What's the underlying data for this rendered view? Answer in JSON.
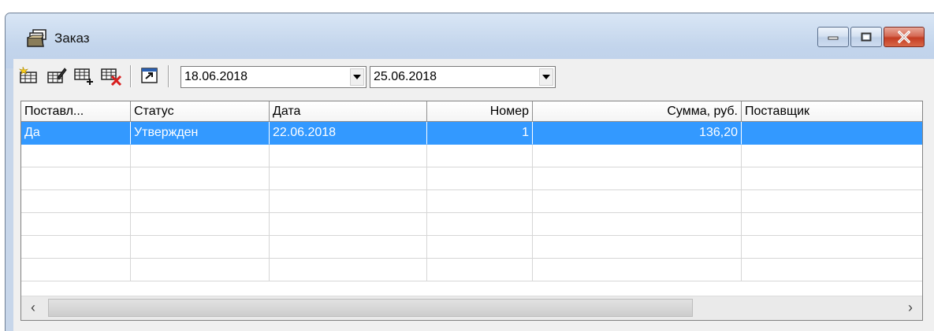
{
  "window": {
    "title": "Заказ",
    "icon": "stacked-documents-icon"
  },
  "toolbar": {
    "buttons": [
      {
        "icon": "new-record-icon"
      },
      {
        "icon": "edit-record-icon"
      },
      {
        "icon": "add-row-icon"
      },
      {
        "icon": "delete-row-icon"
      },
      {
        "icon": "open-document-icon"
      }
    ],
    "date_from": "18.06.2018",
    "date_to": "25.06.2018"
  },
  "grid": {
    "columns": [
      "Поставл...",
      "Статус",
      "Дата",
      "Номер",
      "Сумма, руб.",
      "Поставщик"
    ],
    "rows": [
      {
        "delivered": "Да",
        "status": "Утвержден",
        "date": "22.06.2018",
        "number": "1",
        "sum": "136,20",
        "supplier": ""
      }
    ],
    "empty_rows": 6,
    "selection_color": "#3399ff"
  },
  "scrollbar": {
    "left_arrow": "‹",
    "right_arrow": "›"
  },
  "caption_buttons": {
    "minimize": "minimize-icon",
    "maximize": "maximize-icon",
    "close": "close-icon"
  }
}
